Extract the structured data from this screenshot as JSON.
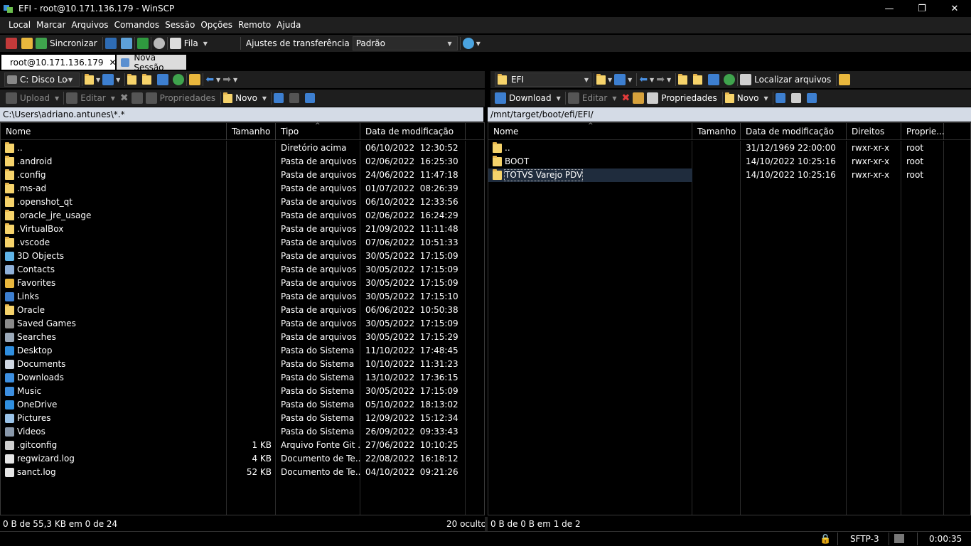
{
  "window": {
    "title": "EFI - root@10.171.136.179 - WinSCP"
  },
  "menu": [
    "Local",
    "Marcar",
    "Arquivos",
    "Comandos",
    "Sessão",
    "Opções",
    "Remoto",
    "Ajuda"
  ],
  "toolbar": {
    "sync_label": "Sincronizar",
    "queue_label": "Fila",
    "transfer_settings_label": "Ajustes de transferência",
    "transfer_preset": "Padrão"
  },
  "tabs": [
    {
      "label": "root@10.171.136.179",
      "active": true
    },
    {
      "label": "Nova Sessão",
      "active": false
    }
  ],
  "local": {
    "drive": "C: Disco Local",
    "path": "C:\\Users\\adriano.antunes\\*.*",
    "actions": {
      "upload": "Upload",
      "edit": "Editar",
      "properties": "Propriedades",
      "new": "Novo"
    },
    "columns": [
      "Nome",
      "Tamanho",
      "Tipo",
      "Data de modificação"
    ],
    "rows": [
      {
        "name": "..",
        "size": "",
        "type": "Diretório acima",
        "date": "06/10/2022  12:30:52",
        "icon": "parent-folder-icon"
      },
      {
        "name": ".android",
        "size": "",
        "type": "Pasta de arquivos",
        "date": "02/06/2022  16:25:30",
        "icon": "folder-icon"
      },
      {
        "name": ".config",
        "size": "",
        "type": "Pasta de arquivos",
        "date": "24/06/2022  11:47:18",
        "icon": "folder-icon"
      },
      {
        "name": ".ms-ad",
        "size": "",
        "type": "Pasta de arquivos",
        "date": "01/07/2022  08:26:39",
        "icon": "folder-icon"
      },
      {
        "name": ".openshot_qt",
        "size": "",
        "type": "Pasta de arquivos",
        "date": "06/10/2022  12:33:56",
        "icon": "folder-icon"
      },
      {
        "name": ".oracle_jre_usage",
        "size": "",
        "type": "Pasta de arquivos",
        "date": "02/06/2022  16:24:29",
        "icon": "folder-icon"
      },
      {
        "name": ".VirtualBox",
        "size": "",
        "type": "Pasta de arquivos",
        "date": "21/09/2022  11:11:48",
        "icon": "folder-icon"
      },
      {
        "name": ".vscode",
        "size": "",
        "type": "Pasta de arquivos",
        "date": "07/06/2022  10:51:33",
        "icon": "folder-icon"
      },
      {
        "name": "3D Objects",
        "size": "",
        "type": "Pasta de arquivos",
        "date": "30/05/2022  17:15:09",
        "icon": "3d-objects-icon"
      },
      {
        "name": "Contacts",
        "size": "",
        "type": "Pasta de arquivos",
        "date": "30/05/2022  17:15:09",
        "icon": "contacts-icon"
      },
      {
        "name": "Favorites",
        "size": "",
        "type": "Pasta de arquivos",
        "date": "30/05/2022  17:15:09",
        "icon": "star-icon"
      },
      {
        "name": "Links",
        "size": "",
        "type": "Pasta de arquivos",
        "date": "30/05/2022  17:15:10",
        "icon": "links-icon"
      },
      {
        "name": "Oracle",
        "size": "",
        "type": "Pasta de arquivos",
        "date": "06/06/2022  10:50:38",
        "icon": "folder-icon"
      },
      {
        "name": "Saved Games",
        "size": "",
        "type": "Pasta de arquivos",
        "date": "30/05/2022  17:15:09",
        "icon": "saved-games-icon"
      },
      {
        "name": "Searches",
        "size": "",
        "type": "Pasta de arquivos",
        "date": "30/05/2022  17:15:29",
        "icon": "search-icon"
      },
      {
        "name": "Desktop",
        "size": "",
        "type": "Pasta do Sistema",
        "date": "11/10/2022  17:48:45",
        "icon": "desktop-icon"
      },
      {
        "name": "Documents",
        "size": "",
        "type": "Pasta do Sistema",
        "date": "10/10/2022  11:31:23",
        "icon": "documents-icon"
      },
      {
        "name": "Downloads",
        "size": "",
        "type": "Pasta do Sistema",
        "date": "13/10/2022  17:36:15",
        "icon": "downloads-icon"
      },
      {
        "name": "Music",
        "size": "",
        "type": "Pasta do Sistema",
        "date": "30/05/2022  17:15:09",
        "icon": "music-icon"
      },
      {
        "name": "OneDrive",
        "size": "",
        "type": "Pasta do Sistema",
        "date": "05/10/2022  18:13:02",
        "icon": "cloud-icon"
      },
      {
        "name": "Pictures",
        "size": "",
        "type": "Pasta do Sistema",
        "date": "12/09/2022  15:12:34",
        "icon": "pictures-icon"
      },
      {
        "name": "Videos",
        "size": "",
        "type": "Pasta do Sistema",
        "date": "26/09/2022  09:33:43",
        "icon": "videos-icon"
      },
      {
        "name": ".gitconfig",
        "size": "1 KB",
        "type": "Arquivo Fonte Git ...",
        "date": "27/06/2022  10:10:25",
        "icon": "file-icon"
      },
      {
        "name": "regwizard.log",
        "size": "4 KB",
        "type": "Documento de Te...",
        "date": "22/08/2022  16:18:12",
        "icon": "text-file-icon"
      },
      {
        "name": "sanct.log",
        "size": "52 KB",
        "type": "Documento de Te...",
        "date": "04/10/2022  09:21:26",
        "icon": "text-file-icon"
      }
    ],
    "status_left": "0 B de 55,3 KB em 0 de 24",
    "status_right": "20 oculto"
  },
  "remote": {
    "dir": "EFI",
    "path": "/mnt/target/boot/efi/EFI/",
    "find_label": "Localizar arquivos",
    "actions": {
      "download": "Download",
      "edit": "Editar",
      "properties": "Propriedades",
      "new": "Novo"
    },
    "columns": [
      "Nome",
      "Tamanho",
      "Data de modificação",
      "Direitos",
      "Proprie..."
    ],
    "rows": [
      {
        "name": "..",
        "size": "",
        "date": "31/12/1969 22:00:00",
        "rights": "rwxr-xr-x",
        "owner": "root",
        "icon": "parent-folder-icon",
        "selected": false
      },
      {
        "name": "BOOT",
        "size": "",
        "date": "14/10/2022 10:25:16",
        "rights": "rwxr-xr-x",
        "owner": "root",
        "icon": "folder-icon",
        "selected": false
      },
      {
        "name": "TOTVS Varejo PDV",
        "size": "",
        "date": "14/10/2022 10:25:16",
        "rights": "rwxr-xr-x",
        "owner": "root",
        "icon": "folder-icon",
        "selected": true
      }
    ],
    "status_left": "0 B de 0 B em 1 de 2"
  },
  "statusbar": {
    "protocol": "SFTP-3",
    "elapsed": "0:00:35"
  }
}
